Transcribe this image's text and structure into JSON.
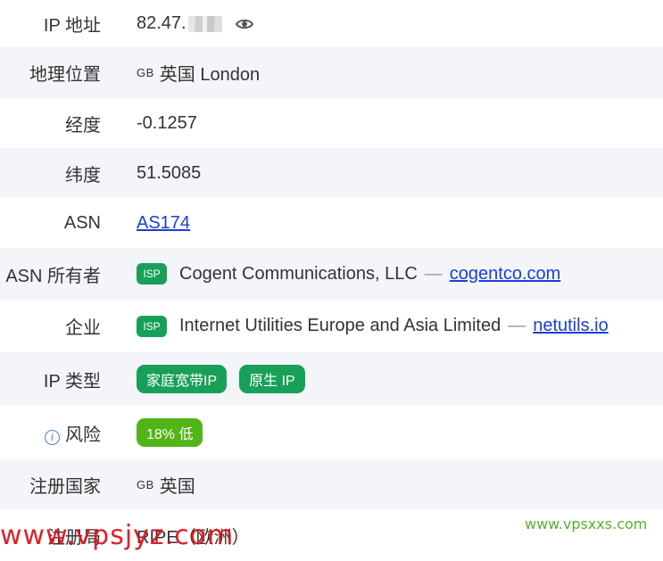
{
  "rows": [
    {
      "label": "IP 地址",
      "ip_partial": "82.47."
    },
    {
      "label": "地理位置",
      "country_code": "GB",
      "location": "英国 London"
    },
    {
      "label": "经度",
      "value": "-0.1257"
    },
    {
      "label": "纬度",
      "value": "51.5085"
    },
    {
      "label": "ASN",
      "link": "AS174"
    },
    {
      "label": "ASN 所有者",
      "badge": "ISP",
      "name": "Cogent Communications, LLC",
      "separator": "—",
      "domain": "cogentco.com"
    },
    {
      "label": "企业",
      "badge": "ISP",
      "name": "Internet Utilities Europe and Asia Limited",
      "separator": "—",
      "domain": "netutils.io"
    },
    {
      "label": "IP 类型",
      "tags": [
        "家庭宽带IP",
        "原生 IP"
      ]
    },
    {
      "label": "风险",
      "info_icon": "i",
      "risk_tag": "18% 低"
    },
    {
      "label": "注册国家",
      "country_code": "GB",
      "value": "英国"
    },
    {
      "label": "注册局",
      "value": "RIPE（欧洲）"
    }
  ],
  "icons": {
    "reveal": "eye-icon",
    "info": "info-circle-icon"
  },
  "colors": {
    "isp_badge": "#18a058",
    "type_tag": "#18a058",
    "risk_low": "#52b416",
    "link": "#1a3fd6",
    "alt_row_bg": "#f3f5f9"
  },
  "watermarks": {
    "left": "www.vpsjyz.com",
    "right": "www.vpsxxs.com"
  }
}
